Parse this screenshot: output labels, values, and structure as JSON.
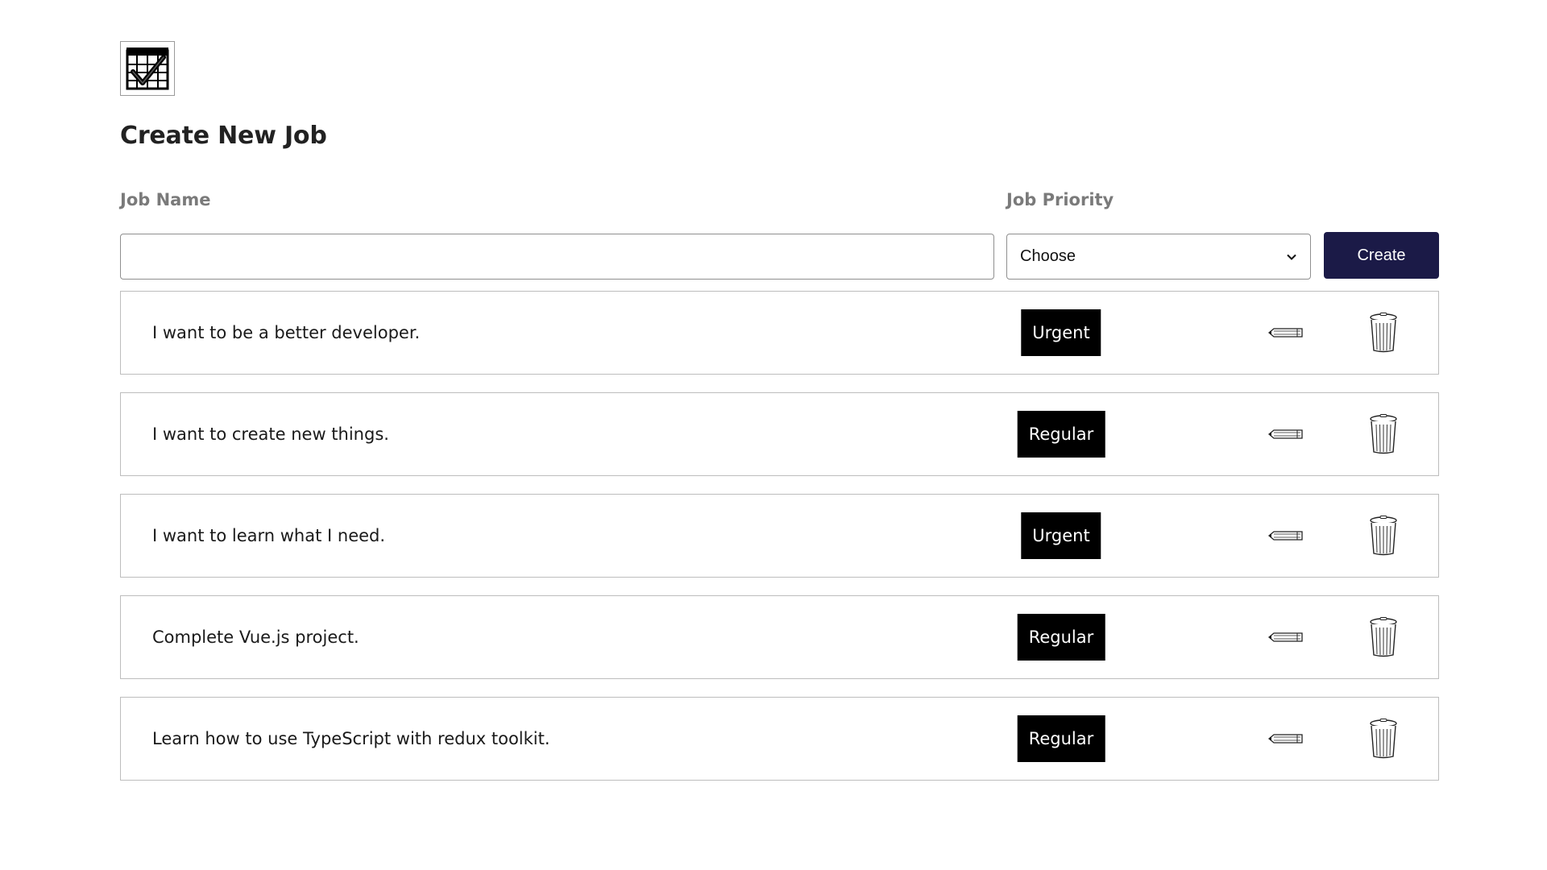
{
  "header": {
    "logo_icon": "calendar-check-icon",
    "title": "Create New Job"
  },
  "form": {
    "name_label": "Job Name",
    "name_value": "",
    "priority_label": "Job Priority",
    "priority_selected": "Choose",
    "create_label": "Create"
  },
  "colors": {
    "create_button": "#1b1a47",
    "badge": "#000000"
  },
  "jobs": [
    {
      "name": "I want to be a better developer.",
      "priority": "Urgent"
    },
    {
      "name": "I want to create new things.",
      "priority": "Regular"
    },
    {
      "name": "I want to learn what I need.",
      "priority": "Urgent"
    },
    {
      "name": "Complete Vue.js project.",
      "priority": "Regular"
    },
    {
      "name": "Learn how to use TypeScript with redux toolkit.",
      "priority": "Regular"
    }
  ],
  "row_icons": {
    "edit": "pencil-icon",
    "delete": "trash-can-icon"
  }
}
